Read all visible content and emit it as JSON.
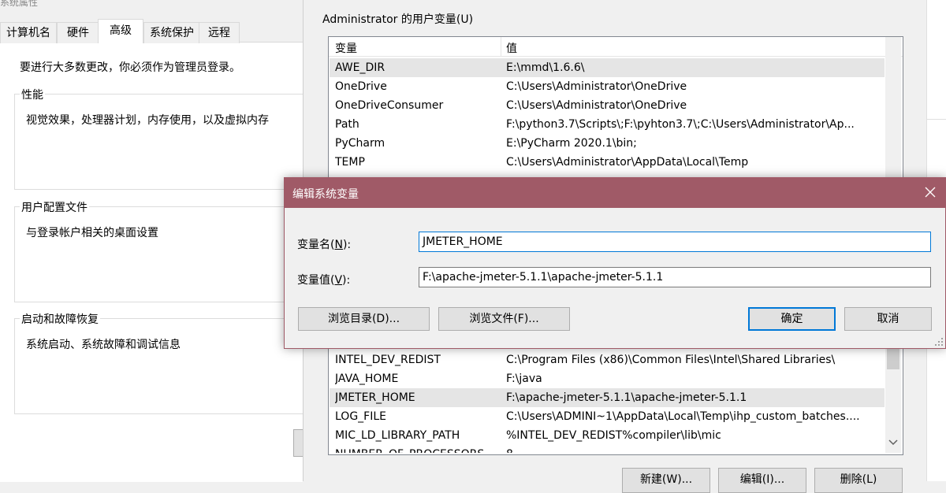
{
  "system_properties": {
    "window_title": "系统属性",
    "tabs": [
      {
        "label": "计算机名",
        "active": false
      },
      {
        "label": "硬件",
        "active": false
      },
      {
        "label": "高级",
        "active": true
      },
      {
        "label": "系统保护",
        "active": false
      },
      {
        "label": "远程",
        "active": false
      }
    ],
    "admin_note": "要进行大多数更改，你必须作为管理员登录。",
    "groups": [
      {
        "title": "性能",
        "desc": "视觉效果，处理器计划，内存使用，以及虚拟内存"
      },
      {
        "title": "用户配置文件",
        "desc": "与登录帐户相关的桌面设置"
      },
      {
        "title": "启动和故障恢复",
        "desc": "系统启动、系统故障和调试信息"
      }
    ]
  },
  "env_vars": {
    "user_section_label": "Administrator 的用户变量(U)",
    "columns": {
      "name": "变量",
      "value": "值"
    },
    "user_vars": [
      {
        "name": "AWE_DIR",
        "value": "E:\\mmd\\1.6.6\\",
        "selected": true
      },
      {
        "name": "OneDrive",
        "value": "C:\\Users\\Administrator\\OneDrive"
      },
      {
        "name": "OneDriveConsumer",
        "value": "C:\\Users\\Administrator\\OneDrive"
      },
      {
        "name": "Path",
        "value": "F:\\python3.7\\Scripts\\;F:\\pyhton3.7\\;C:\\Users\\Administrator\\Ap..."
      },
      {
        "name": "PyCharm",
        "value": "E:\\PyCharm 2020.1\\bin;"
      },
      {
        "name": "TEMP",
        "value": "C:\\Users\\Administrator\\AppData\\Local\\Temp"
      }
    ],
    "system_vars": [
      {
        "name": "INTEL_DEV_REDIST",
        "value": "C:\\Program Files (x86)\\Common Files\\Intel\\Shared Libraries\\"
      },
      {
        "name": "JAVA_HOME",
        "value": "F:\\java"
      },
      {
        "name": "JMETER_HOME",
        "value": "F:\\apache-jmeter-5.1.1\\apache-jmeter-5.1.1",
        "selected": true
      },
      {
        "name": "LOG_FILE",
        "value": "C:\\Users\\ADMINI~1\\AppData\\Local\\Temp\\ihp_custom_batches...."
      },
      {
        "name": "MIC_LD_LIBRARY_PATH",
        "value": "%INTEL_DEV_REDIST%compiler\\lib\\mic"
      },
      {
        "name": "NUMBER_OF_PROCESSORS",
        "value": "8"
      }
    ],
    "bottom_buttons": {
      "new": "新建(W)...",
      "edit": "编辑(I)...",
      "delete": "删除(L)"
    }
  },
  "edit_dialog": {
    "title": "编辑系统变量",
    "name_label": "变量名(",
    "name_key": "N",
    "name_label_end": "):",
    "name_value": "JMETER_HOME",
    "value_label": "变量值(",
    "value_key": "V",
    "value_label_end": "):",
    "value_value": "F:\\apache-jmeter-5.1.1\\apache-jmeter-5.1.1",
    "browse_dir": "浏览目录(D)...",
    "browse_file": "浏览文件(F)...",
    "ok": "确定",
    "cancel": "取消"
  },
  "colors": {
    "dialog_titlebar": "#a05a67",
    "focus_border": "#0078d7",
    "selection": "#e5e5e5"
  }
}
